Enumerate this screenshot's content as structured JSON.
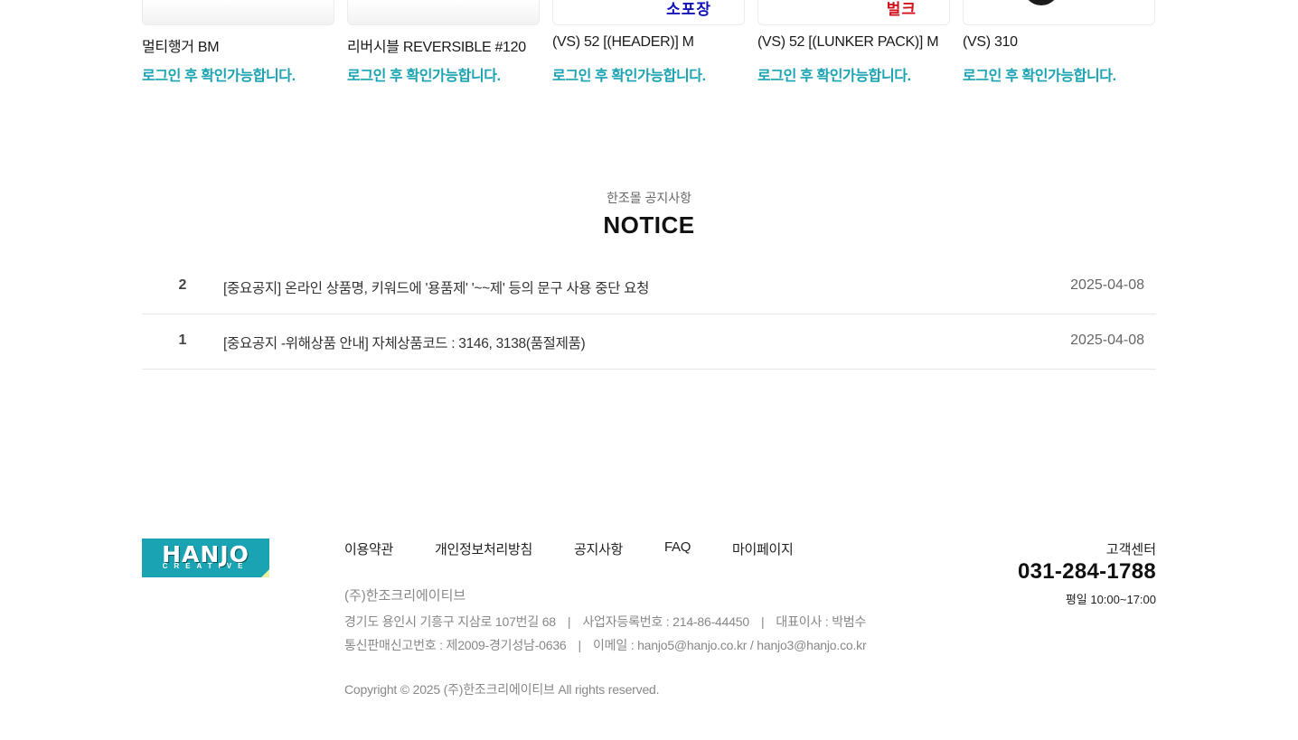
{
  "products": [
    {
      "name": "멀티행거 BM",
      "price_note": "로그인 후 확인가능합니다.",
      "thumb_text": ""
    },
    {
      "name": "리버시블 REVERSIBLE #120",
      "price_note": "로그인 후 확인가능합니다.",
      "thumb_text": ""
    },
    {
      "name": "(VS) 52 [(HEADER)] M",
      "price_note": "로그인 후 확인가능합니다.",
      "thumb_text": "소포장"
    },
    {
      "name": "(VS) 52 [(LUNKER PACK)] M",
      "price_note": "로그인 후 확인가능합니다.",
      "thumb_text": "벌크"
    },
    {
      "name": "(VS) 310",
      "price_note": "로그인 후 확인가능합니다.",
      "thumb_text": ""
    }
  ],
  "notice": {
    "subtitle": "한조몰 공지사항",
    "title": "NOTICE",
    "rows": [
      {
        "num": "2",
        "subject": "[중요공지] 온라인 상품명, 키워드에 '용품제' '~~제' 등의 문구 사용 중단 요청",
        "date": "2025-04-08"
      },
      {
        "num": "1",
        "subject": "[중요공지 -위해상품 안내] 자체상품코드 : 3146, 3138(품절제품)",
        "date": "2025-04-08"
      }
    ]
  },
  "footer": {
    "logo_text": "HANJO",
    "logo_sub": "CREATIVE",
    "nav": [
      "이용약관",
      "개인정보처리방침",
      "공지사항",
      "FAQ",
      "마이페이지"
    ],
    "company": "(주)한조크리에이티브",
    "address": "경기도 용인시 기흥구 지삼로 107번길 68",
    "biz_no": "사업자등록번호 : 214-86-44450",
    "ceo": "대표이사 : 박범수",
    "mail_order_no": "통신판매신고번호 : 제2009-경기성남-0636",
    "email": "이메일 : hanjo5@hanjo.co.kr / hanjo3@hanjo.co.kr",
    "copyright": "Copyright © 2025 (주)한조크리에이티브 All rights reserved.",
    "cs_label": "고객센터",
    "cs_phone": "031-284-1788",
    "cs_hours": "평일 10:00~17:00"
  },
  "colors": {
    "accent": "#1aa3b2",
    "thumb_blue_text": "#1212b8",
    "thumb_red_text": "#d0121b"
  }
}
